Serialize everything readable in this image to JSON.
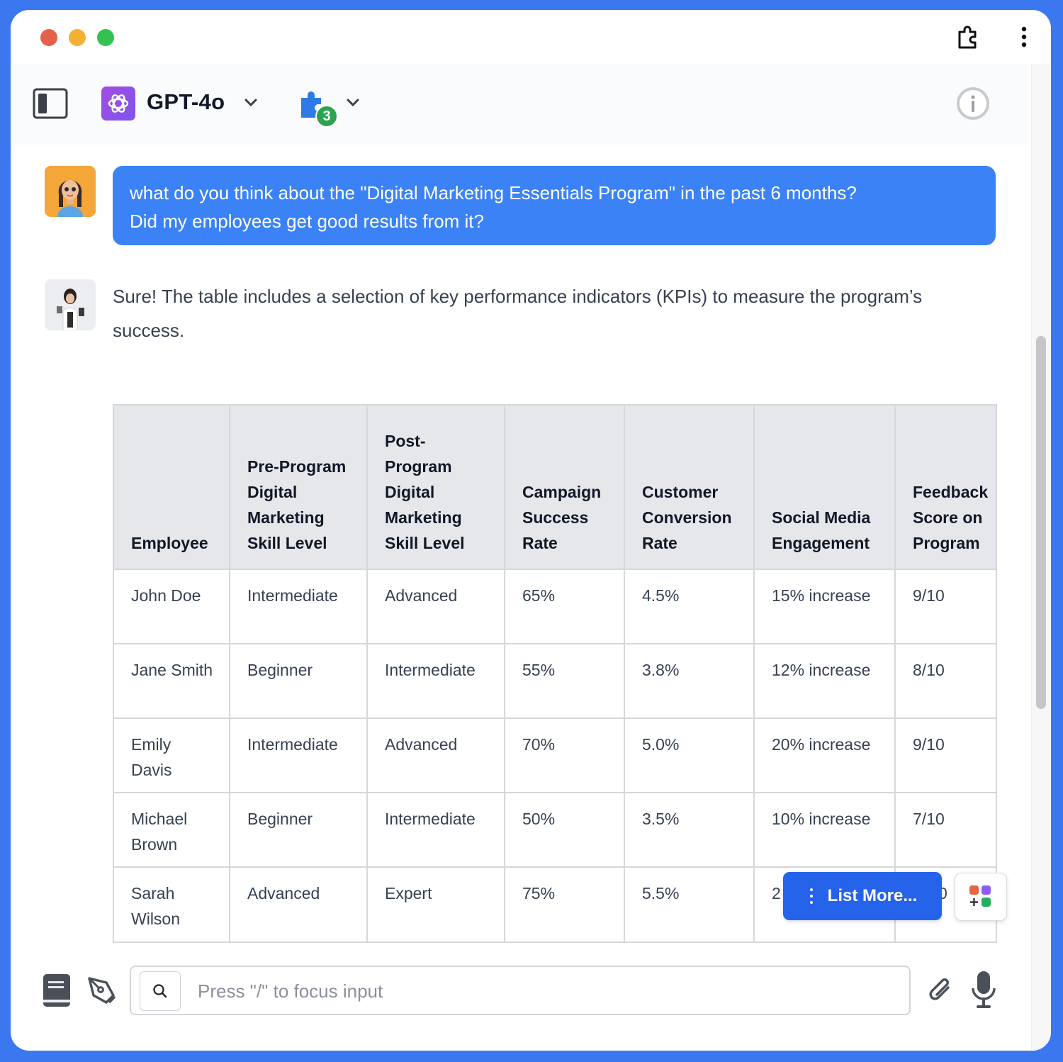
{
  "window": {
    "traffic_lights": [
      "close",
      "minimize",
      "maximize"
    ]
  },
  "header": {
    "model_name": "GPT-4o",
    "plugin_count": "3"
  },
  "conversation": {
    "user_message": {
      "line1": "what do you think about the \"Digital Marketing Essentials Program\" in the past 6 months?",
      "line2": "Did my employees get good results from it?"
    },
    "assistant_message": {
      "text": "Sure! The table includes a selection of key performance indicators (KPIs) to measure the program’s success."
    },
    "table": {
      "headers": [
        "Employee",
        "Pre-Program Digital Marketing Skill Level",
        "Post-Program Digital Marketing Skill Level",
        "Campaign Success Rate",
        "Customer Conversion Rate",
        "Social Media Engagement",
        "Feedback Score on Program"
      ],
      "rows": [
        [
          "John Doe",
          "Intermediate",
          "Advanced",
          "65%",
          "4.5%",
          "15% increase",
          "9/10"
        ],
        [
          "Jane Smith",
          "Beginner",
          "Intermediate",
          "55%",
          "3.8%",
          "12% increase",
          "8/10"
        ],
        [
          "Emily Davis",
          "Intermediate",
          "Advanced",
          "70%",
          "5.0%",
          "20% increase",
          "9/10"
        ],
        [
          "Michael Brown",
          "Beginner",
          "Intermediate",
          "50%",
          "3.5%",
          "10% increase",
          "7/10"
        ],
        [
          "Sarah Wilson",
          "Advanced",
          "Expert",
          "75%",
          "5.5%",
          "2",
          "0"
        ]
      ]
    }
  },
  "actions": {
    "list_more_label": "List More..."
  },
  "input": {
    "placeholder": "Press \"/\" to focus input"
  },
  "colors": {
    "frame": "#3b78f0",
    "user_bubble": "#3a82f6",
    "list_more": "#2563eb",
    "table_header": "#e5e7eb"
  }
}
